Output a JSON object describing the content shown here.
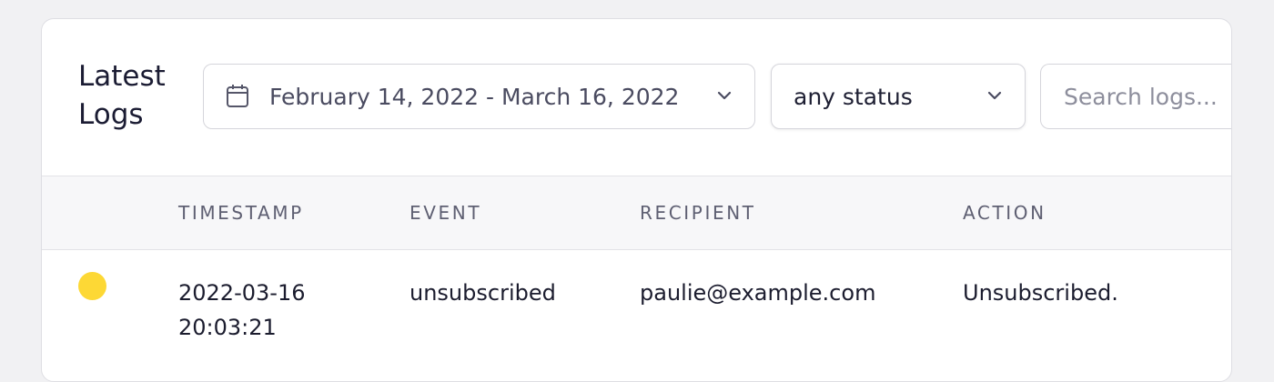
{
  "header": {
    "title_line1": "Latest",
    "title_line2": "Logs"
  },
  "date_range": {
    "value": "February 14, 2022 - March 16, 2022",
    "icon": "calendar-icon"
  },
  "status_filter": {
    "selected": "any status",
    "icon": "chevron-down-icon"
  },
  "search": {
    "placeholder": "Search logs..."
  },
  "table": {
    "columns": [
      "TIMESTAMP",
      "EVENT",
      "RECIPIENT",
      "ACTION"
    ],
    "rows": [
      {
        "status_color": "#fdd835",
        "timestamp_date": "2022-03-16",
        "timestamp_time": "20:03:21",
        "event": "unsubscribed",
        "recipient": "paulie@example.com",
        "action": "Unsubscribed."
      }
    ]
  }
}
